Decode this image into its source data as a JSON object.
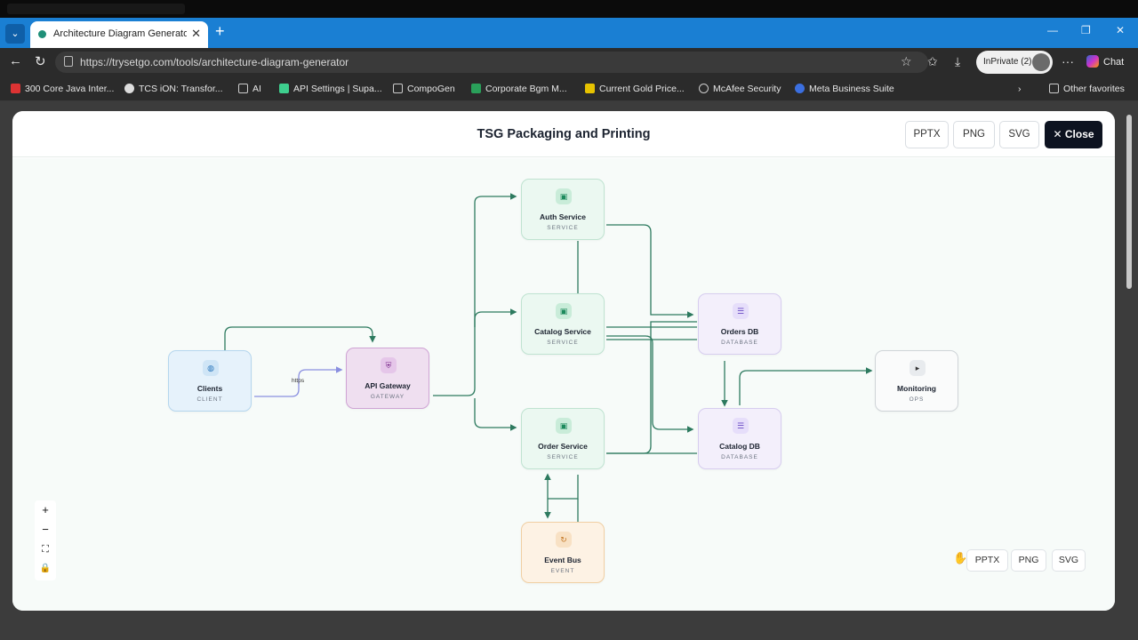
{
  "browser": {
    "tab_title": "Architecture Diagram Generator |",
    "url": "https://trysetgo.com/tools/architecture-diagram-generator",
    "inprivate": "InPrivate (2)",
    "chat": "Chat",
    "bookmarks": [
      "300 Core Java Inter...",
      "TCS iON: Transfor...",
      "AI",
      "API Settings | Supa...",
      "CompoGen",
      "Corporate Bgm M...",
      "Current Gold Price...",
      "McAfee Security",
      "Meta Business Suite"
    ],
    "other_favorites": "Other favorites"
  },
  "modal": {
    "title": "TSG Packaging and Printing",
    "header_buttons": [
      "PPTX",
      "PNG",
      "SVG"
    ],
    "close_label": "Close",
    "bottom_buttons": [
      "PPTX",
      "PNG",
      "SVG"
    ]
  },
  "diagram": {
    "nodes": {
      "clients": {
        "label": "Clients",
        "type": "CLIENT",
        "icon": "globe-icon"
      },
      "gateway": {
        "label": "API Gateway",
        "type": "GATEWAY",
        "icon": "shield-icon"
      },
      "auth": {
        "label": "Auth Service",
        "type": "SERVICE",
        "icon": "chip-icon"
      },
      "catalog": {
        "label": "Catalog Service",
        "type": "SERVICE",
        "icon": "chip-icon"
      },
      "order": {
        "label": "Order Service",
        "type": "SERVICE",
        "icon": "chip-icon"
      },
      "ordersdb": {
        "label": "Orders DB",
        "type": "DATABASE",
        "icon": "database-icon"
      },
      "catalogdb": {
        "label": "Catalog DB",
        "type": "DATABASE",
        "icon": "database-icon"
      },
      "eventbus": {
        "label": "Event Bus",
        "type": "EVENT",
        "icon": "refresh-icon"
      },
      "monitoring": {
        "label": "Monitoring",
        "type": "OPS",
        "icon": "terminal-icon"
      }
    },
    "edge_label": "https"
  },
  "zoom_controls": [
    "+",
    "−",
    "⛶",
    "🔒"
  ],
  "colors": {
    "edge": "#2d7a5f",
    "edge_https": "#8a8fe0",
    "accent": "#1a7fd3"
  }
}
